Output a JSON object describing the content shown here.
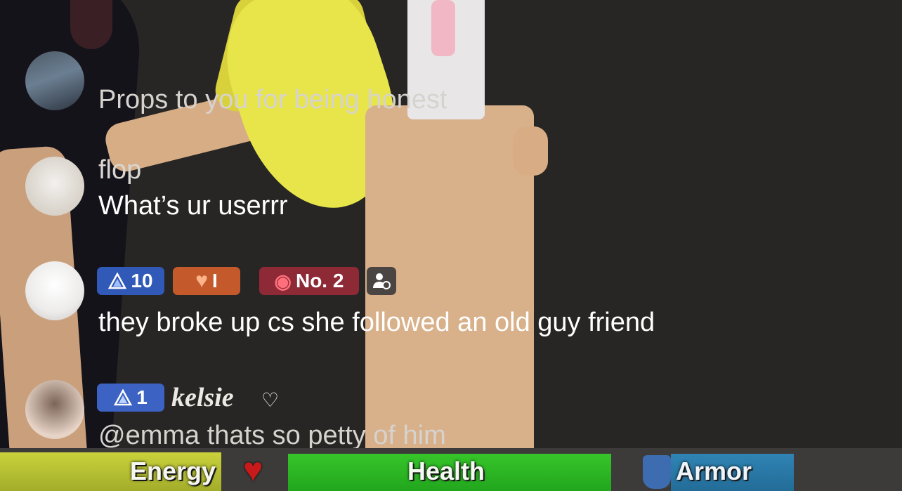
{
  "comments": [
    {
      "username": "",
      "message": "Props to you for being honest"
    },
    {
      "username": "flop",
      "message": "What’s ur userrr"
    },
    {
      "badges": {
        "level": "10",
        "fan_level": "I",
        "rank": "No. 2"
      },
      "message": "they broke up cs she followed an old guy friend"
    },
    {
      "badges": {
        "level": "1"
      },
      "username": "kelsie",
      "message": "@emma thats so petty of him"
    }
  ],
  "hud": {
    "energy_label": "Energy",
    "health_label": "Health",
    "armor_label": "Armor"
  }
}
